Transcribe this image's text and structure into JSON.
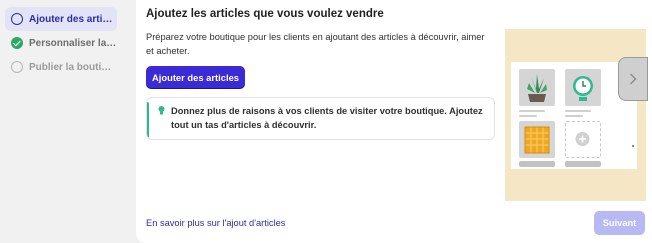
{
  "sidebar": {
    "steps": [
      {
        "label": "Ajouter des articles",
        "state": "active"
      },
      {
        "label": "Personnaliser la b...",
        "state": "done"
      },
      {
        "label": "Publier la boutique",
        "state": "todo"
      }
    ]
  },
  "main": {
    "title": "Ajoutez les articles que vous voulez vendre",
    "description": "Préparez votre boutique pour les clients en ajoutant des articles à découvrir, aimer et acheter.",
    "primary_button": "Ajouter des articles",
    "tip": "Donnez plus de raisons à vos clients de visiter votre boutique. Ajoutez tout un tas d'articles à découvrir.",
    "learn_more_link": "En savoir plus sur l'ajout d'articles",
    "next_button": "Suivant"
  },
  "icons": {
    "step_active": "radio-ring-icon",
    "step_done": "check-circle-icon",
    "step_todo": "empty-circle-icon",
    "tip": "lightbulb-icon",
    "carousel_next": "chevron-right-icon"
  },
  "colors": {
    "accent": "#3a2bd6",
    "accent_active_bg": "#e3e3f7",
    "success": "#2fa866",
    "tip_bar": "#2fb98e",
    "next_disabled": "#b7b8f4",
    "illustration_bg": "#f5e6c5"
  }
}
